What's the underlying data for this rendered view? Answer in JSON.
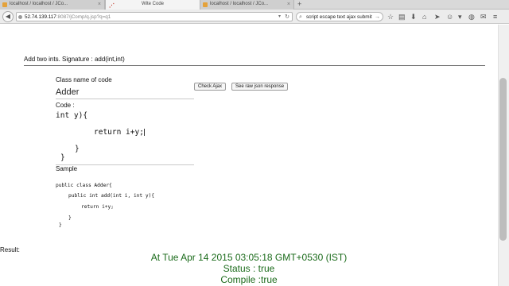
{
  "browser": {
    "tabs": [
      {
        "title": "localhost / localhost / JCo..."
      },
      {
        "title": "Wite Code"
      },
      {
        "title": "localhost / localhost / JCo..."
      }
    ],
    "url_host": "52.74.139.117",
    "url_path": ":8087/jComp/q.jsp?q=q1",
    "search_text": "script escape text ajax submit"
  },
  "page": {
    "signature": "Add two ints. Signature : add(int,int)",
    "classname_label": "Class name of code",
    "classname_value": "Adder",
    "check_ajax_label": "Check Ajax",
    "raw_json_label": "See raw json response",
    "code_label": "Code :",
    "code_lines": [
      "int y){",
      "return i+y;",
      "}",
      "}"
    ],
    "sample_label": "Sample",
    "sample_lines": [
      "public class Adder{",
      "public int add(int i, int y){",
      "return i+y;",
      "}",
      "}"
    ],
    "result_label": "Result:",
    "result_lines": [
      "At Tue Apr 14 2015 03:05:18 GMT+0530 (IST)",
      "Status : true",
      "Compile :true"
    ],
    "result_color": "#1b6b1b"
  }
}
